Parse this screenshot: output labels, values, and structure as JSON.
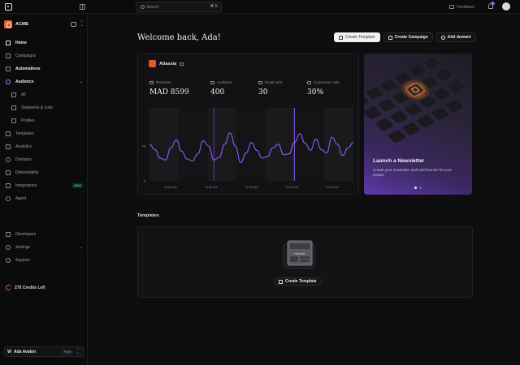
{
  "topbar": {
    "search_placeholder": "Search",
    "search_shortcut": "⌘ K",
    "feedback_label": "Feedback",
    "notification_count": "1"
  },
  "sidebar": {
    "workspace_name": "ACME",
    "items": [
      {
        "label": "Home",
        "icon": "home-icon",
        "active": true
      },
      {
        "label": "Campaigns",
        "icon": "send-icon"
      },
      {
        "label": "Automations",
        "icon": "automation-icon",
        "bold": true
      },
      {
        "label": "Audience",
        "icon": "users-icon",
        "expanded": true
      },
      {
        "label": "All",
        "icon": "list-icon"
      },
      {
        "label": "Segments & Lists",
        "icon": "segments-icon"
      },
      {
        "label": "Profiles",
        "icon": "profile-icon"
      },
      {
        "label": "Templates",
        "icon": "template-icon"
      },
      {
        "label": "Analytics",
        "icon": "chart-icon"
      },
      {
        "label": "Domains",
        "icon": "globe-icon"
      },
      {
        "label": "Deliverability",
        "icon": "mail-icon"
      },
      {
        "label": "Integrations",
        "icon": "plug-icon",
        "badge": "NEW"
      },
      {
        "label": "Agent",
        "icon": "agent-icon"
      }
    ],
    "bottom_items": [
      {
        "label": "Developers",
        "icon": "code-icon"
      },
      {
        "label": "Settings",
        "icon": "gear-icon"
      },
      {
        "label": "Support",
        "icon": "help-icon"
      }
    ],
    "credits_label": "270 Credits Left",
    "user": {
      "initial": "W",
      "name": "Ada Avalon",
      "plan": "Free"
    }
  },
  "main": {
    "welcome": "Welcome back, Ada!",
    "actions": {
      "create_template": "Create Template",
      "create_campaign": "Create Campaign",
      "add_domain": "Add domain"
    },
    "stats": {
      "account_name": "Atlassia",
      "metrics": [
        {
          "label": "Revenue",
          "value": "MAD 8599"
        },
        {
          "label": "Audience",
          "value": "400"
        },
        {
          "label": "Email sent",
          "value": "30"
        },
        {
          "label": "Conversion rate",
          "value": "30%"
        }
      ]
    },
    "promo": {
      "title": "Launch a Newsletter",
      "text": "Create your newsletter and build funnels for your project",
      "slide_index": 1,
      "slide_count": 2
    },
    "templates": {
      "heading": "Templates",
      "create_label": "Create Template",
      "illustration_label": "New item"
    }
  },
  "colors": {
    "accent": "#7c4ddb",
    "line": "#8b5cf6",
    "brand_orange": "#e35a2a",
    "success": "#2ecc71"
  },
  "chart_data": {
    "type": "line",
    "x_ticks": [
      "10:00 AM",
      "10:00 AM",
      "12:00 AM",
      "10:00 AM",
      "10:00 AM"
    ],
    "y_ticks": [
      "40",
      "0"
    ],
    "ylim": [
      0,
      80
    ],
    "values": [
      42,
      36,
      26,
      24,
      38,
      47,
      34,
      25,
      23,
      31,
      46,
      40,
      24,
      27,
      42,
      55,
      40,
      21,
      32,
      44,
      35,
      26,
      28,
      38,
      42,
      30,
      31,
      44,
      54,
      43,
      35,
      48,
      36,
      32,
      50,
      42,
      29,
      38,
      44
    ]
  }
}
